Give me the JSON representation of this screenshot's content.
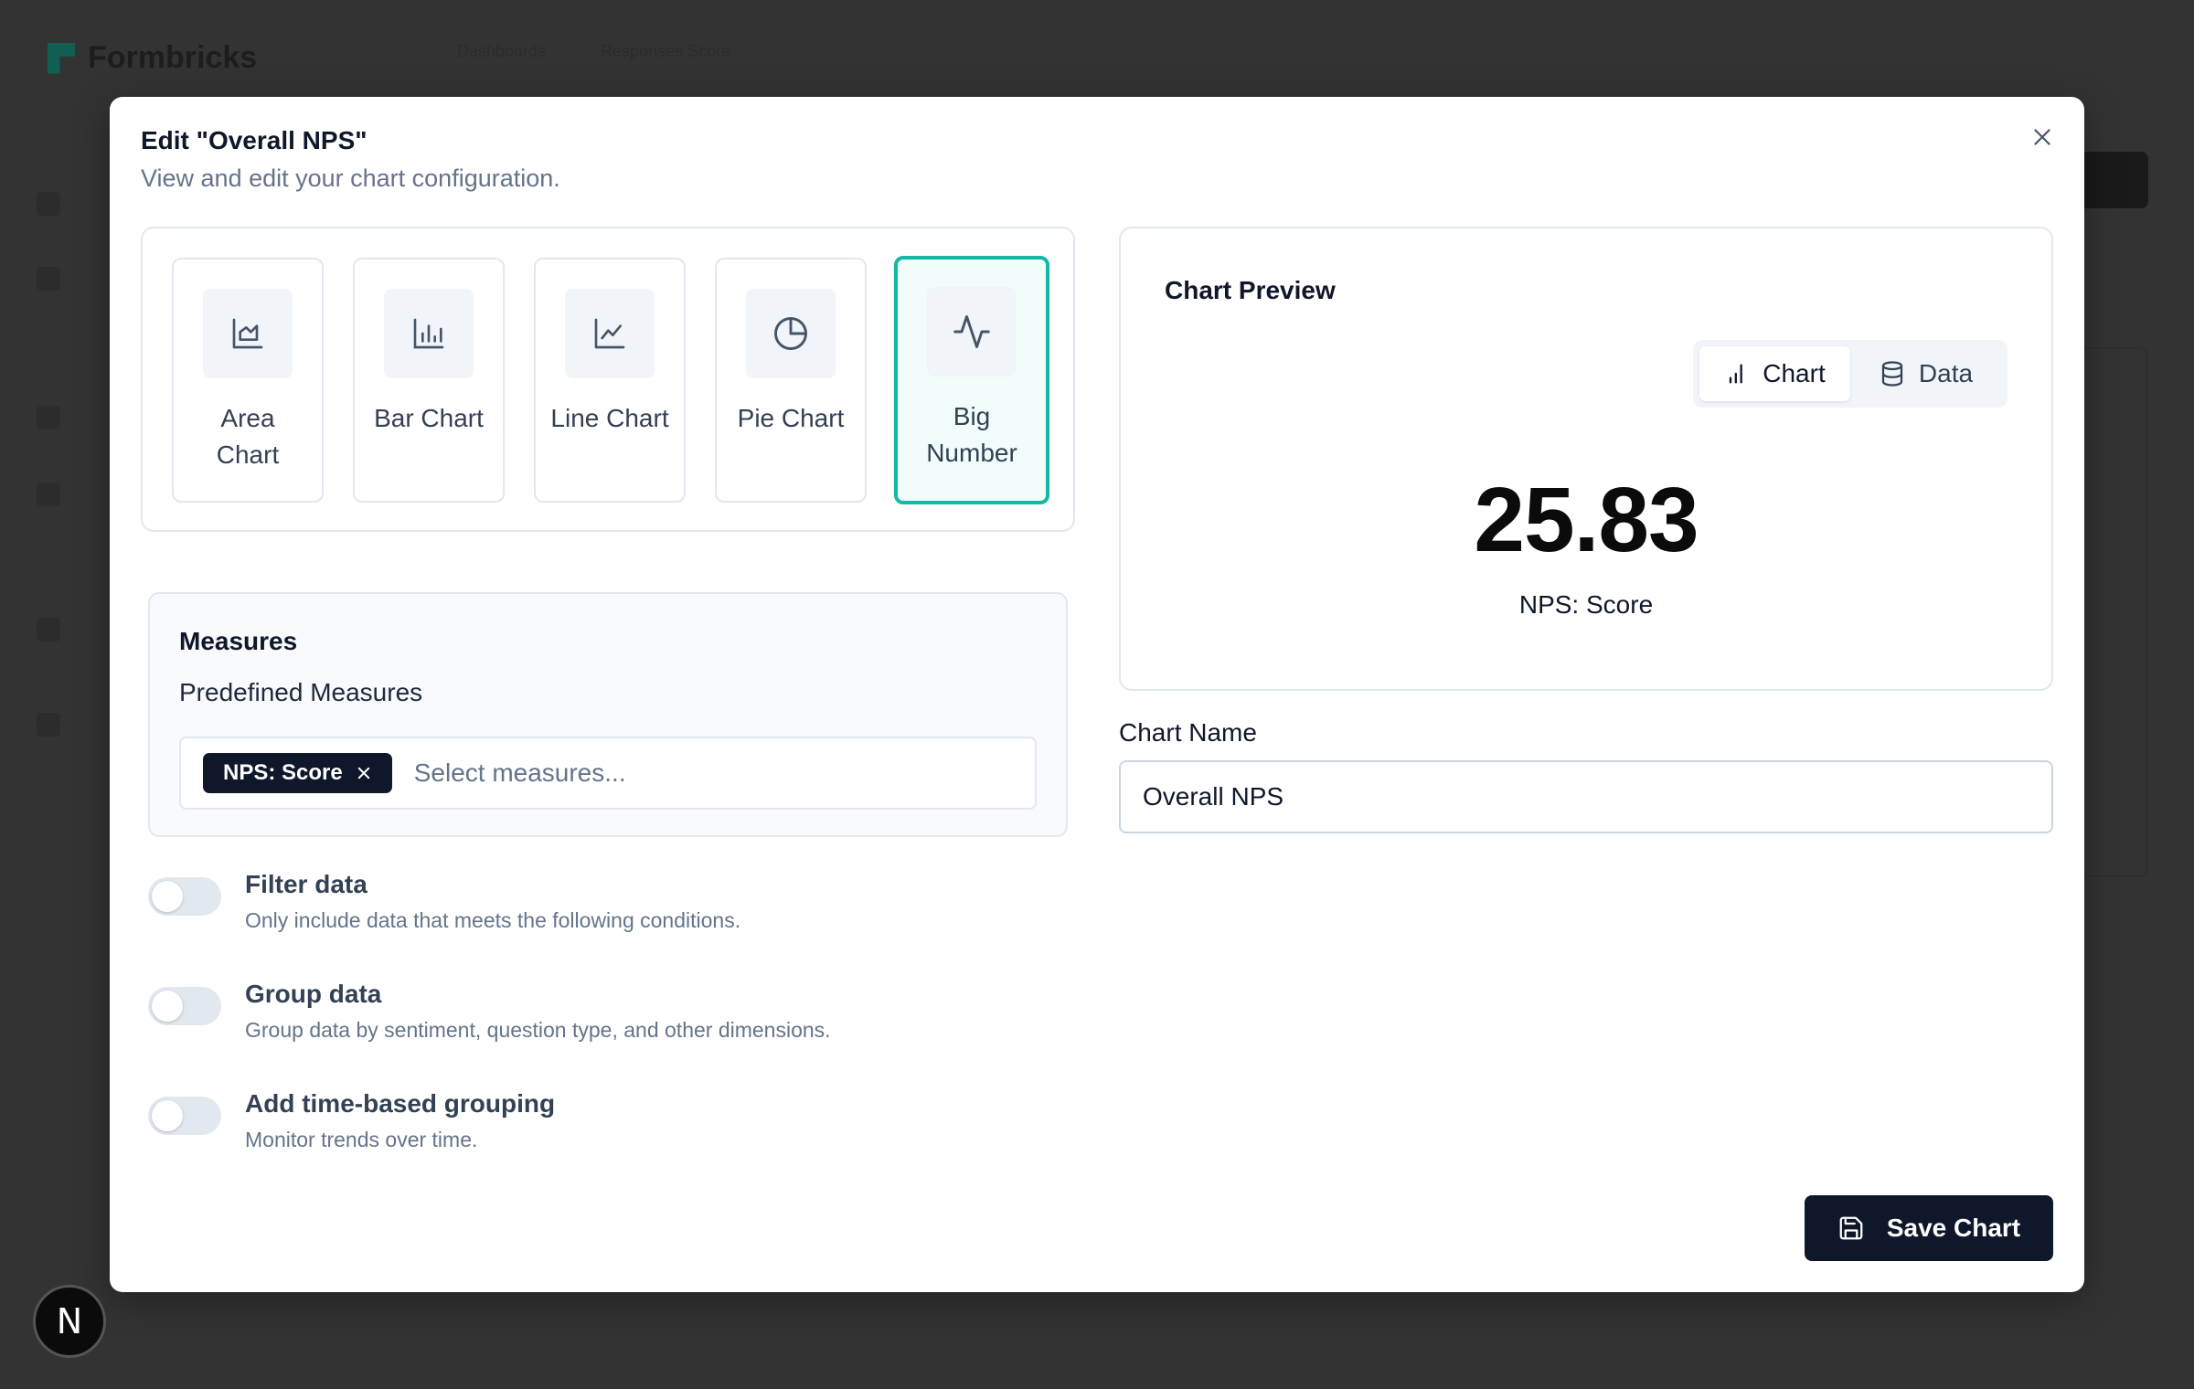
{
  "background": {
    "app_name": "Formbricks",
    "crumbs": [
      "Dashboards",
      "Responses Score"
    ]
  },
  "modal": {
    "title": "Edit \"Overall NPS\"",
    "subtitle": "View and edit your chart configuration."
  },
  "chart_types": [
    {
      "label": "Area Chart",
      "icon": "area-chart-icon",
      "selected": false
    },
    {
      "label": "Bar Chart",
      "icon": "bar-chart-icon",
      "selected": false
    },
    {
      "label": "Line Chart",
      "icon": "line-chart-icon",
      "selected": false
    },
    {
      "label": "Pie Chart",
      "icon": "pie-chart-icon",
      "selected": false
    },
    {
      "label": "Big Number",
      "icon": "activity-icon",
      "selected": true
    }
  ],
  "measures": {
    "title": "Measures",
    "subtitle": "Predefined Measures",
    "selected_chip": "NPS: Score",
    "placeholder": "Select measures..."
  },
  "toggles": [
    {
      "title": "Filter data",
      "description": "Only include data that meets the following conditions.",
      "on": false
    },
    {
      "title": "Group data",
      "description": "Group data by sentiment, question type, and other dimensions.",
      "on": false
    },
    {
      "title": "Add time-based grouping",
      "description": "Monitor trends over time.",
      "on": false
    }
  ],
  "preview": {
    "title": "Chart Preview",
    "tabs": {
      "chart": "Chart",
      "data": "Data",
      "active": "chart"
    },
    "value": "25.83",
    "value_label": "NPS: Score"
  },
  "chart_name": {
    "label": "Chart Name",
    "value": "Overall NPS"
  },
  "save_label": "Save Chart",
  "colors": {
    "accent": "#14b8a6",
    "primary": "#0f172a"
  },
  "badge_letter": "N"
}
